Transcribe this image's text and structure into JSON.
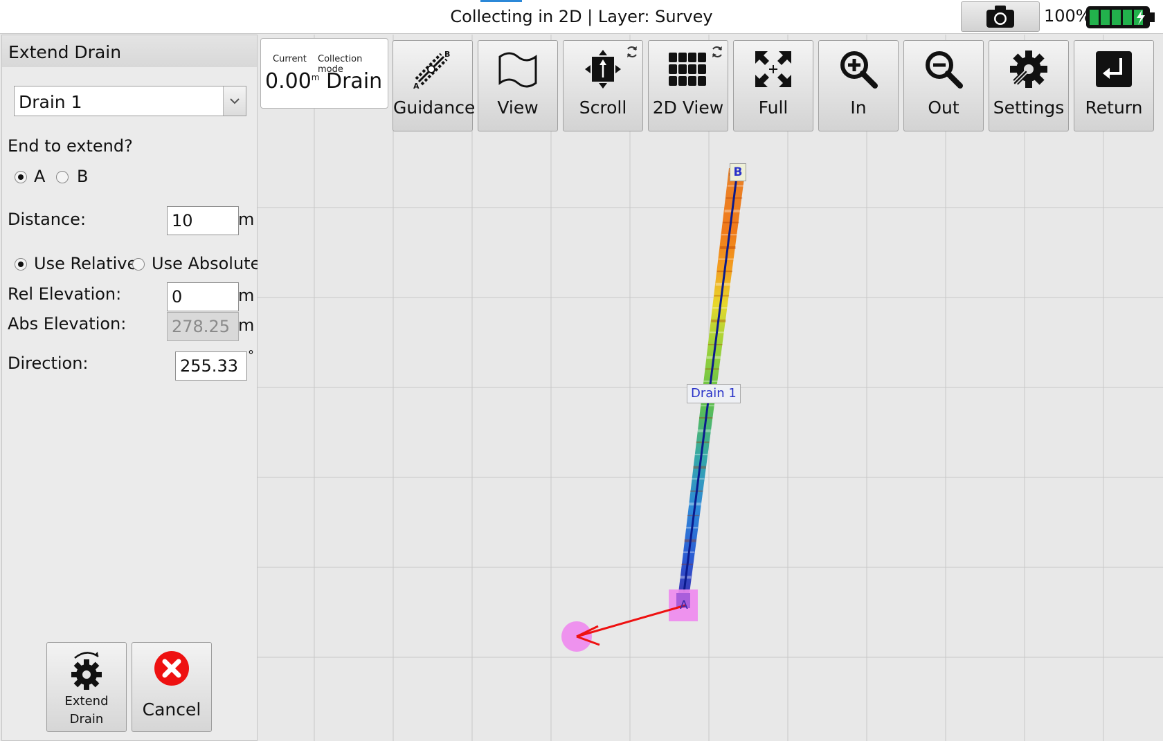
{
  "titlebar": {
    "title": "Collecting in 2D | Layer: Survey",
    "battery_percent": "100%",
    "battery_level": 1.0,
    "icons": [
      "camera-icon",
      "battery-icon"
    ]
  },
  "panel": {
    "title": "Extend Drain",
    "drain_select": {
      "value": "Drain 1"
    },
    "end_question": "End to extend?",
    "end_options": [
      {
        "label": "A",
        "selected": true
      },
      {
        "label": "B",
        "selected": false
      }
    ],
    "distance_label": "Distance:",
    "distance_value": "10",
    "distance_unit": "m",
    "mode_options": [
      {
        "label": "Use Relative",
        "selected": true
      },
      {
        "label": "Use Absolute",
        "selected": false
      }
    ],
    "rel_elev_label": "Rel Elevation:",
    "rel_elev_value": "0",
    "rel_elev_unit": "m",
    "abs_elev_label": "Abs Elevation:",
    "abs_elev_value": "278.25",
    "abs_elev_unit": "m",
    "direction_label": "Direction:",
    "direction_value": "255.33",
    "direction_unit": "°",
    "extend_button": {
      "line1": "Extend",
      "line2": "Drain",
      "icon": "gear-icon"
    },
    "cancel_button": {
      "label": "Cancel",
      "icon": "close-icon"
    }
  },
  "status": {
    "current_label": "Current",
    "current_value": "0.00",
    "current_unit": "m",
    "mode_label": "Collection mode",
    "mode_value": "Drain"
  },
  "toolbar": [
    {
      "label": "Guidance",
      "icon": "guidance-icon"
    },
    {
      "label": "View",
      "icon": "map-icon"
    },
    {
      "label": "Scroll",
      "icon": "scroll-icon"
    },
    {
      "label": "2D View",
      "icon": "grid-icon"
    },
    {
      "label": "Full",
      "icon": "full-extent-icon"
    },
    {
      "label": "In",
      "icon": "zoom-in-icon"
    },
    {
      "label": "Out",
      "icon": "zoom-out-icon"
    },
    {
      "label": "Settings",
      "icon": "settings-icon"
    },
    {
      "label": "Return",
      "icon": "return-icon"
    }
  ],
  "map": {
    "drain_label": "Drain 1",
    "end_a": "A",
    "end_b": "B",
    "colors": {
      "drain_line": "#0a1a8c",
      "marker": "#ee88ee",
      "arrow": "#ee1111",
      "grid": "#c8c8c8"
    }
  }
}
